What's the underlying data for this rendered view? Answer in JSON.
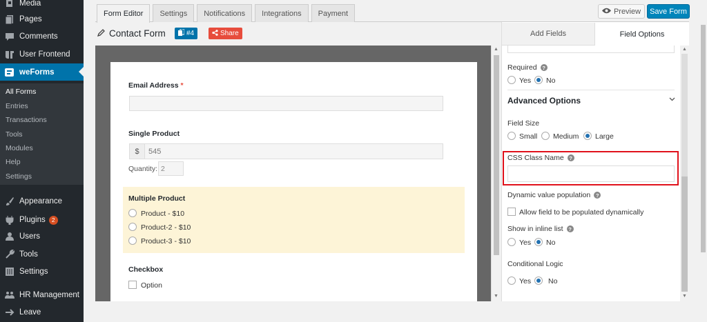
{
  "sidebar": {
    "top_items": [
      {
        "label": "Media",
        "icon": "media-icon"
      },
      {
        "label": "Pages",
        "icon": "pages-icon"
      },
      {
        "label": "Comments",
        "icon": "comments-icon"
      },
      {
        "label": "User Frontend",
        "icon": "user-frontend-icon"
      },
      {
        "label": "weForms",
        "icon": "weforms-icon"
      }
    ],
    "submenu": [
      "All Forms",
      "Entries",
      "Transactions",
      "Tools",
      "Modules",
      "Help",
      "Settings"
    ],
    "bottom_items": [
      {
        "label": "Appearance",
        "icon": "appearance-icon"
      },
      {
        "label": "Plugins",
        "icon": "plugins-icon",
        "badge": "2"
      },
      {
        "label": "Users",
        "icon": "users-icon"
      },
      {
        "label": "Tools",
        "icon": "tools-icon"
      },
      {
        "label": "Settings",
        "icon": "settings-icon"
      },
      {
        "label": "HR Management",
        "icon": "hr-icon"
      },
      {
        "label": "Leave",
        "icon": "leave-icon"
      }
    ]
  },
  "editor_tabs": [
    "Form Editor",
    "Settings",
    "Notifications",
    "Integrations",
    "Payment"
  ],
  "toolbar": {
    "preview_label": "Preview",
    "save_label": "Save Form"
  },
  "form": {
    "title": "Contact Form",
    "id_label": "#4",
    "share_label": "Share"
  },
  "preview": {
    "email_label": "Email Address",
    "required_mark": "*",
    "product_label": "Single Product",
    "product_prefix": "$",
    "product_value": "545",
    "quantity_label": "Quantity:",
    "quantity_value": "2",
    "multi_label": "Multiple Product",
    "multi_options": [
      "Product - $10",
      "Product-2 - $10",
      "Product-3 - $10"
    ],
    "checkbox_label": "Checkbox",
    "checkbox_option": "Option"
  },
  "panel": {
    "tab_add": "Add Fields",
    "tab_options": "Field Options",
    "required_label": "Required",
    "yes": "Yes",
    "no": "No",
    "advanced_heading": "Advanced Options",
    "field_size_label": "Field Size",
    "size_small": "Small",
    "size_medium": "Medium",
    "size_large": "Large",
    "css_label": "CSS Class Name",
    "dynamic_label": "Dynamic value population",
    "dynamic_checkbox": "Allow field to be populated dynamically",
    "inline_label": "Show in inline list",
    "conditional_label": "Conditional Logic",
    "help_glyph": "?"
  },
  "colors": {
    "sidebar_bg": "#23282d",
    "active": "#0073aa",
    "save_button": "#0085ba",
    "share": "#e74c3c",
    "highlight": "#e0101a"
  }
}
